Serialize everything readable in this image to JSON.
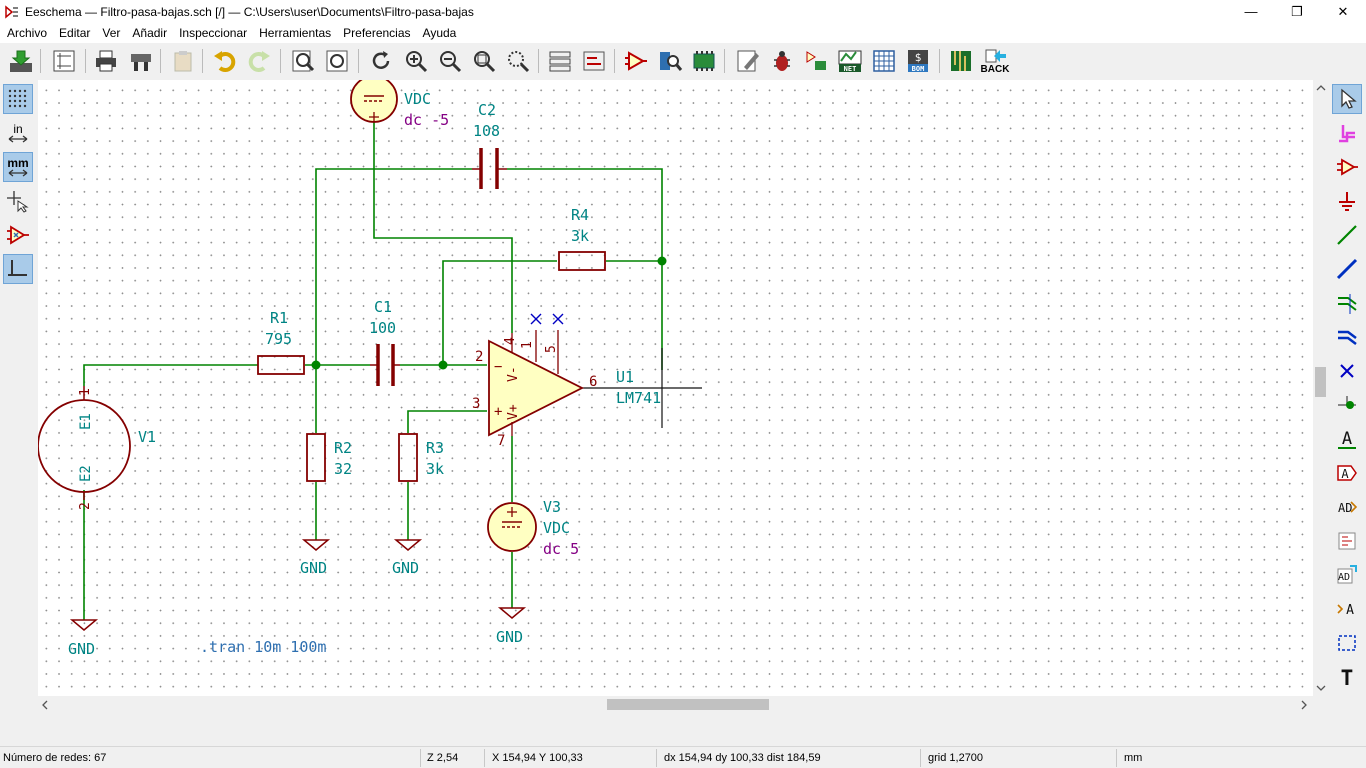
{
  "window": {
    "title": "Eeschema — Filtro-pasa-bajas.sch [/] — C:\\Users\\user\\Documents\\Filtro-pasa-bajas",
    "minimize": "—",
    "maximize": "❐",
    "close": "✕"
  },
  "menu": [
    "Archivo",
    "Editar",
    "Ver",
    "Añadir",
    "Inspeccionar",
    "Herramientas",
    "Preferencias",
    "Ayuda"
  ],
  "toolbar": {
    "back_label": "BACK",
    "net_label": "NET",
    "bom_label": "BOM"
  },
  "left_toolbar": {
    "units_in": "in",
    "units_mm": "mm"
  },
  "schematic": {
    "V2": {
      "value": "VDC",
      "param": "dc -5"
    },
    "C2": {
      "ref": "C2",
      "value": "108"
    },
    "R4": {
      "ref": "R4",
      "value": "3k"
    },
    "R1": {
      "ref": "R1",
      "value": "795"
    },
    "C1": {
      "ref": "C1",
      "value": "100"
    },
    "R2": {
      "ref": "R2",
      "value": "32"
    },
    "R3": {
      "ref": "R3",
      "value": "3k"
    },
    "U1": {
      "ref": "U1",
      "value": "LM741"
    },
    "V1": {
      "ref": "V1",
      "pin_e1": "E1",
      "pin_e2": "E2",
      "pin1": "1",
      "pin2": "2"
    },
    "V3": {
      "ref": "V3",
      "value": "VDC",
      "param": "dc 5"
    },
    "gnd": "GND",
    "spice": ".tran 10m 100m",
    "pins": {
      "p1": "1",
      "p2": "2",
      "p3": "3",
      "p4": "4",
      "p5": "5",
      "p6": "6",
      "p7": "7",
      "minus": "−",
      "plus": "+",
      "vm": "V-",
      "vp": "V+"
    }
  },
  "status": {
    "nets": "Número de redes: 67",
    "zoom": "Z 2,54",
    "xy": "X 154,94  Y 100,33",
    "delta": "dx 154,94  dy 100,33  dist 184,59",
    "grid": "grid 1,2700",
    "units": "mm"
  },
  "colors": {
    "wire": "#008400",
    "component": "#840000",
    "component_fill": "#ffffc2",
    "ref_text": "#008484",
    "value_text": "#008484",
    "field_text": "#840084",
    "junction": "#008400",
    "noconnect": "#0000c2"
  }
}
